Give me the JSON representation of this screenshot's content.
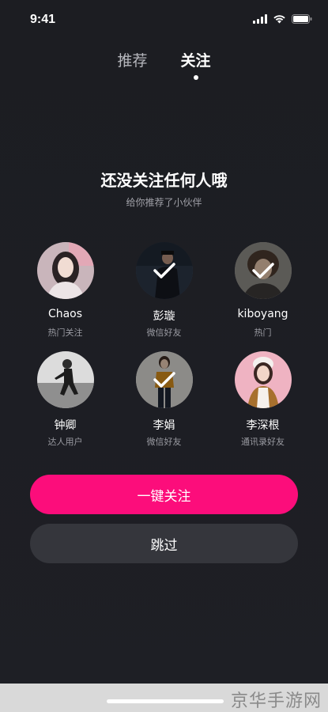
{
  "status_bar": {
    "time": "9:41",
    "icons": [
      "signal-icon",
      "wifi-icon",
      "battery-icon"
    ]
  },
  "tabs": [
    {
      "label": "推荐",
      "active": false
    },
    {
      "label": "关注",
      "active": true
    }
  ],
  "empty_state": {
    "title": "还没关注任何人哦",
    "subtitle": "给你推荐了小伙伴"
  },
  "users": [
    {
      "name": "Chaos",
      "desc": "热门关注",
      "selected": false
    },
    {
      "name": "彭璇",
      "desc": "微信好友",
      "selected": true
    },
    {
      "name": "kiboyang",
      "desc": "热门",
      "selected": true
    },
    {
      "name": "钟卿",
      "desc": "达人用户",
      "selected": false
    },
    {
      "name": "李娟",
      "desc": "微信好友",
      "selected": true
    },
    {
      "name": "李深根",
      "desc": "通讯录好友",
      "selected": false
    }
  ],
  "actions": {
    "follow_all_label": "一键关注",
    "skip_label": "跳过"
  },
  "colors": {
    "background": "#1d1e24",
    "accent": "#fc0d7b",
    "secondary_button": "#35363c"
  },
  "watermark": "京华手游网"
}
